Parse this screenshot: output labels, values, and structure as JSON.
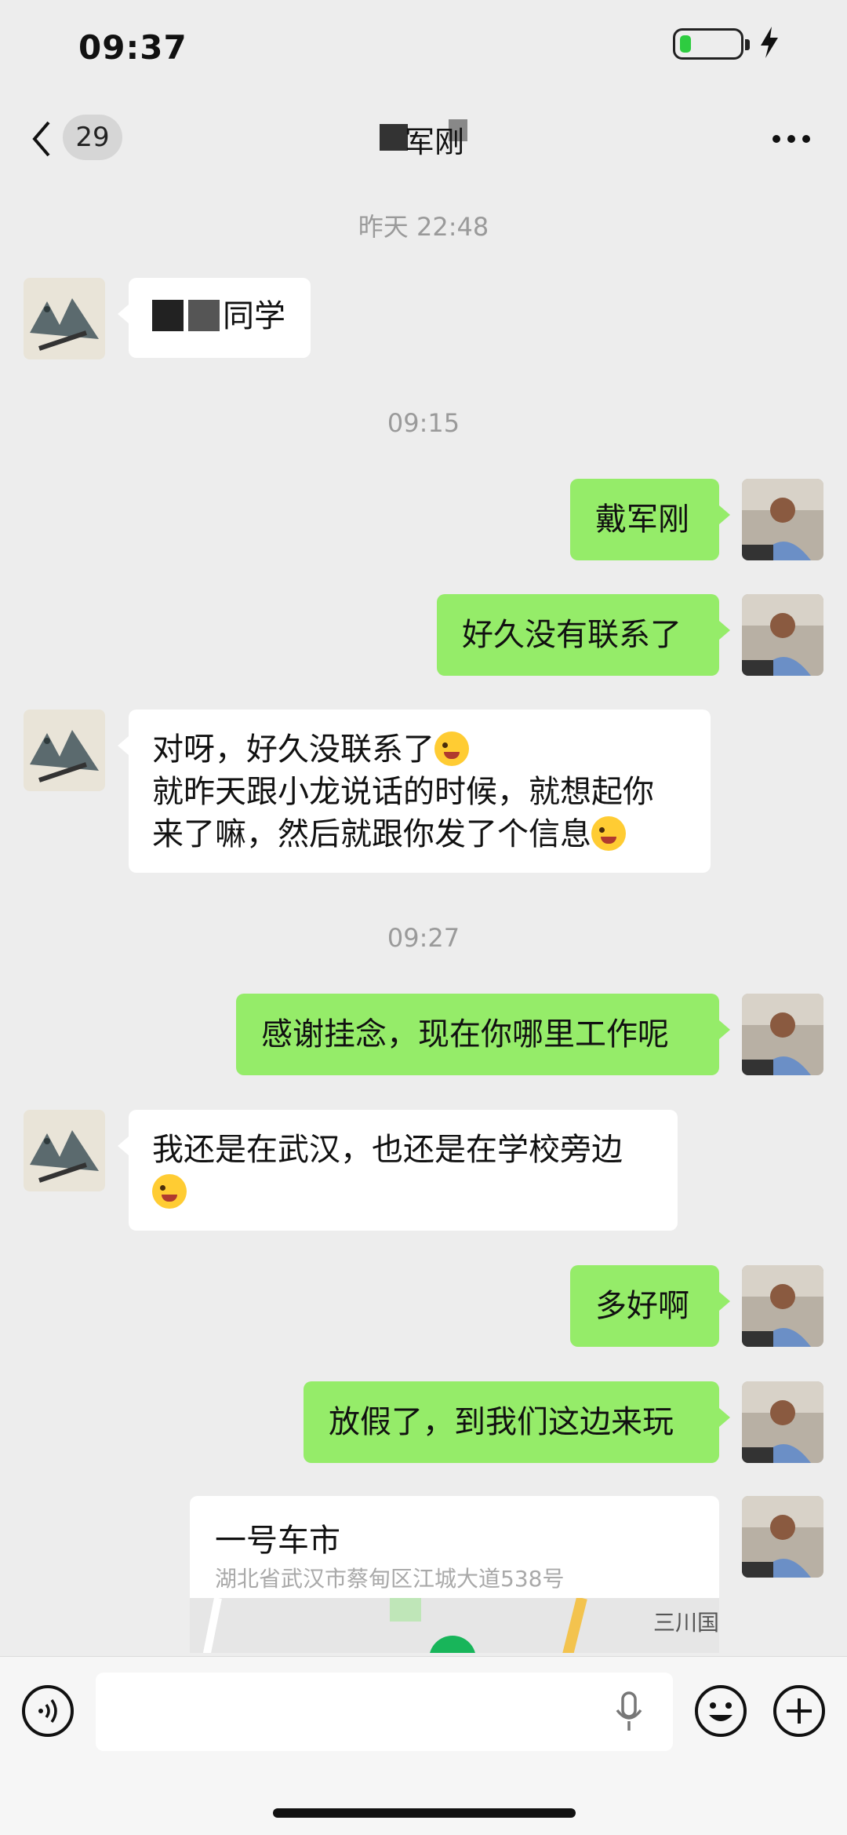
{
  "status_bar": {
    "time": "09:37",
    "battery_level": 0.2
  },
  "nav": {
    "unread_count": "29",
    "title": "军刚"
  },
  "timestamps": [
    "昨天 22:48",
    "09:15",
    "09:27"
  ],
  "messages": [
    {
      "side": "left",
      "text": "同学"
    },
    {
      "side": "right",
      "text": "戴军刚"
    },
    {
      "side": "right",
      "text": "好久没有联系了"
    },
    {
      "side": "left",
      "lines": [
        "对呀，好久没联系了",
        "就昨天跟小龙说话的时候，就想起你",
        "来了嘛，然后就跟你发了个信息"
      ],
      "emoji": [
        "winking-face",
        "laughing-face"
      ]
    },
    {
      "side": "right",
      "text": "感谢挂念，现在你哪里工作呢"
    },
    {
      "side": "left",
      "text": "我还是在武汉，也还是在学校旁边",
      "emoji": [
        "winking-tongue-face"
      ]
    },
    {
      "side": "right",
      "text": "多好啊"
    },
    {
      "side": "right",
      "text": "放假了，到我们这边来玩"
    }
  ],
  "location": {
    "name": "一号车市",
    "address": "湖北省武汉市蔡甸区江城大道538号",
    "poi": "三川国"
  },
  "colors": {
    "background": "#ededed",
    "green_bubble": "#95ec69",
    "white_bubble": "#ffffff",
    "timestamp": "#9a9a9a"
  },
  "icons": {
    "back": "chevron-left-icon",
    "more": "more-dots-icon",
    "voice": "voice-icon",
    "mic": "microphone-icon",
    "emoji": "emoji-icon",
    "add": "plus-icon"
  }
}
